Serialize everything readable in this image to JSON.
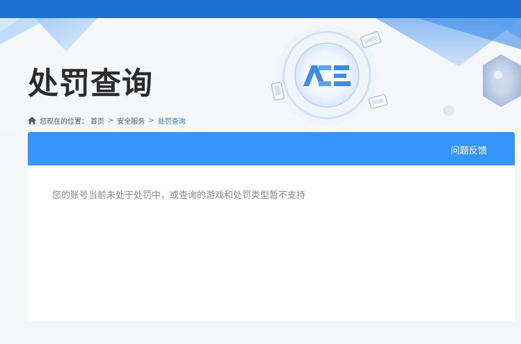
{
  "header": {
    "page_title": "处罚查询"
  },
  "breadcrumb": {
    "prefix": "您现在的位置：",
    "items": [
      "首页",
      "安全服务",
      "处罚查询"
    ],
    "separator": ">"
  },
  "panel": {
    "feedback_label": "问题反馈",
    "message": "您的账号当前未处于处罚中，或查询的游戏和处罚类型暂不支持"
  },
  "colors": {
    "topbar": "#1f6fd1",
    "panel_header": "#3595fc",
    "breadcrumb_current": "#2a7ad8"
  },
  "icons": {
    "home": "home-icon",
    "logo": "ace-logo",
    "game_card": "game-card-icon",
    "phone": "phone-icon"
  }
}
